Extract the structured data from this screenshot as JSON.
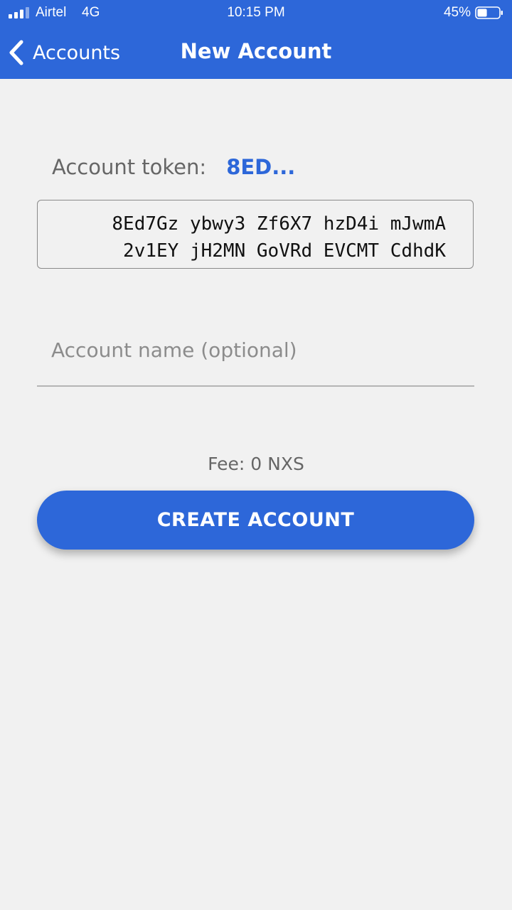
{
  "status_bar": {
    "carrier": "Airtel",
    "network": "4G",
    "time": "10:15 PM",
    "battery_percent": "45%",
    "signal_icon": "cellular-signal-icon",
    "battery_icon": "battery-icon",
    "battery_level": 0.45
  },
  "nav": {
    "back_label": "Accounts",
    "back_icon": "chevron-left-icon",
    "title": "New Account"
  },
  "token": {
    "label": "Account token:",
    "short": "8ED...",
    "lines": [
      "8Ed7Gz ybwy3 Zf6X7 hzD4i mJwmA",
      "2v1EY jH2MN GoVRd EVCMT CdhdK"
    ]
  },
  "name_field": {
    "placeholder": "Account name (optional)",
    "value": ""
  },
  "fee": {
    "text": "Fee: 0 NXS"
  },
  "create_button": {
    "label": "CREATE ACCOUNT"
  },
  "colors": {
    "accent": "#2d67d9",
    "background": "#f1f1f1"
  }
}
